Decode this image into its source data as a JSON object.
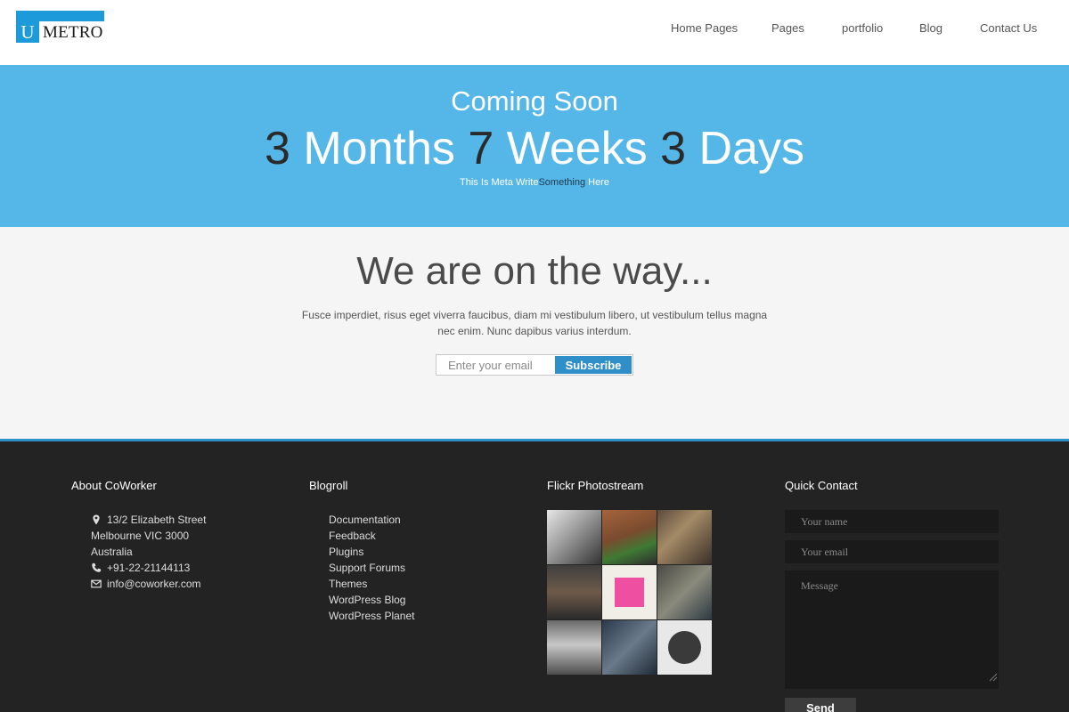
{
  "logo": {
    "letter": "U",
    "text": "METRO"
  },
  "nav": {
    "items": [
      {
        "label": "Home Pages"
      },
      {
        "label": "Pages"
      },
      {
        "label": "portfolio"
      },
      {
        "label": "Blog"
      },
      {
        "label": "Contact Us"
      }
    ]
  },
  "hero": {
    "title": "Coming Soon",
    "countdown": {
      "months_value": "3",
      "months_label": "Months",
      "weeks_value": "7",
      "weeks_label": "Weeks",
      "days_value": "3",
      "days_label": "Days"
    },
    "meta": {
      "part1": "This Is Meta",
      "part2": "Write",
      "part3": "Something",
      "part4": "Here"
    }
  },
  "main": {
    "title": "We are on the way...",
    "text": "Fusce imperdiet, risus eget viverra faucibus, diam mi vestibulum libero, ut vestibulum tellus magna nec enim. Nunc dapibus varius interdum.",
    "subscribe": {
      "placeholder": "Enter your email",
      "button": "Subscribe"
    }
  },
  "footer": {
    "about": {
      "title": "About CoWorker",
      "address_line1": "13/2 Elizabeth Street",
      "address_line2": "Melbourne VIC 3000",
      "address_line3": "Australia",
      "phone": "+91-22-21144113",
      "email": "info@coworker.com"
    },
    "blogroll": {
      "title": "Blogroll",
      "links": [
        "Documentation",
        "Feedback",
        "Plugins",
        "Support Forums",
        "Themes",
        "WordPress Blog",
        "WordPress Planet"
      ]
    },
    "flickr": {
      "title": "Flickr Photostream"
    },
    "quick_contact": {
      "title": "Quick Contact",
      "name_placeholder": "Your name",
      "email_placeholder": "Your email",
      "message_placeholder": "Message",
      "send": "Send"
    }
  },
  "colors": {
    "accent": "#55b6e8",
    "brand": "#1d9ad9",
    "button": "#2f8fc9",
    "footer_bg": "#232323",
    "main_bg": "#f5f5f5"
  }
}
